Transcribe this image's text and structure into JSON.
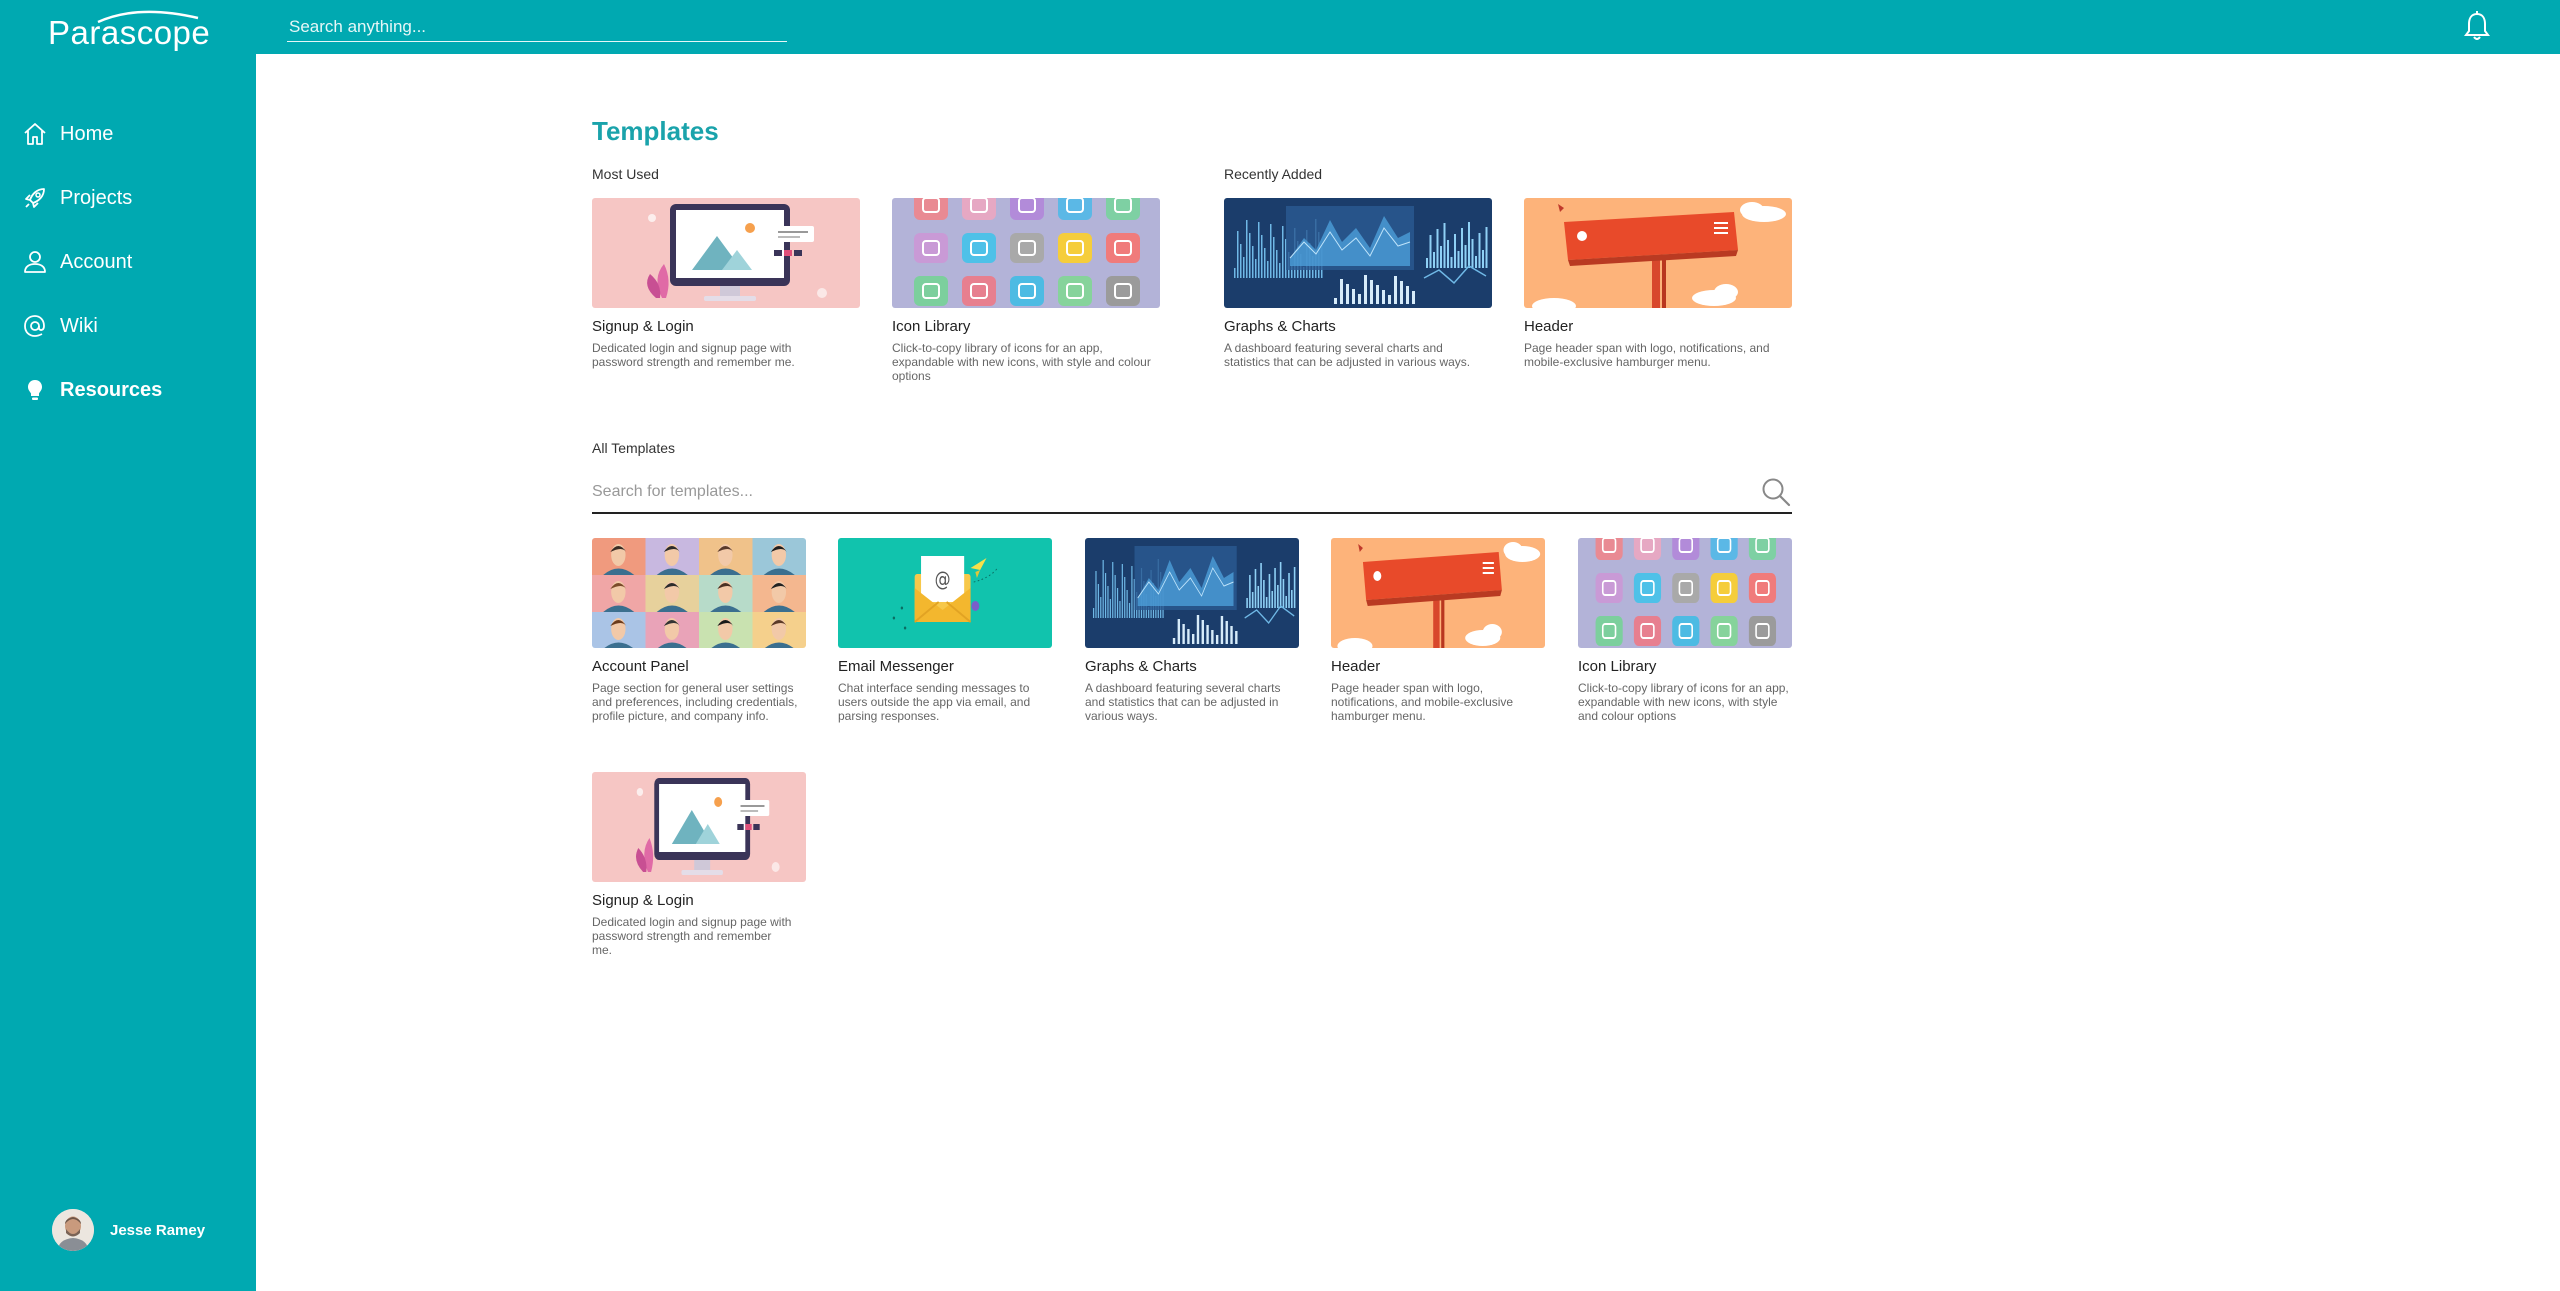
{
  "app": {
    "name": "Parascope"
  },
  "header": {
    "search_placeholder": "Search anything..."
  },
  "sidebar": {
    "items": [
      {
        "label": "Home",
        "icon": "home-icon"
      },
      {
        "label": "Projects",
        "icon": "rocket-icon"
      },
      {
        "label": "Account",
        "icon": "user-icon"
      },
      {
        "label": "Wiki",
        "icon": "at-icon"
      },
      {
        "label": "Resources",
        "icon": "lightbulb-icon",
        "active": true
      }
    ],
    "user": {
      "name": "Jesse Ramey"
    }
  },
  "main": {
    "title": "Templates",
    "most_used_label": "Most Used",
    "recently_added_label": "Recently Added",
    "all_templates_label": "All Templates",
    "search_placeholder": "Search for templates...",
    "most_used": [
      {
        "title": "Signup & Login",
        "desc": "Dedicated login and signup page with password strength and remember me.",
        "thumb": "signup"
      },
      {
        "title": "Icon Library",
        "desc": "Click-to-copy library of icons for an app, expandable with new icons, with style and colour options",
        "thumb": "icons"
      }
    ],
    "recently_added": [
      {
        "title": "Graphs & Charts",
        "desc": "A dashboard featuring several charts and statistics that can be adjusted in various ways.",
        "thumb": "graphs"
      },
      {
        "title": "Header",
        "desc": "Page header span with logo, notifications, and mobile-exclusive hamburger menu.",
        "thumb": "header"
      }
    ],
    "all": [
      {
        "title": "Account Panel",
        "desc": "Page section for general user settings and preferences, including credentials, profile picture, and company info.",
        "thumb": "account"
      },
      {
        "title": "Email Messenger",
        "desc": "Chat interface sending messages to users outside the app via email, and parsing responses.",
        "thumb": "email"
      },
      {
        "title": "Graphs & Charts",
        "desc": "A dashboard featuring several charts and statistics that can be adjusted in various ways.",
        "thumb": "graphs"
      },
      {
        "title": "Header",
        "desc": "Page header span with logo, notifications, and mobile-exclusive hamburger menu.",
        "thumb": "header"
      },
      {
        "title": "Icon Library",
        "desc": "Click-to-copy library of icons for an app, expandable with new icons, with style and colour options",
        "thumb": "icons"
      },
      {
        "title": "Signup & Login",
        "desc": "Dedicated login and signup page with password strength and remember me.",
        "thumb": "signup"
      }
    ]
  },
  "colors": {
    "brand": "#00a9b1",
    "title": "#1aa3ab"
  }
}
